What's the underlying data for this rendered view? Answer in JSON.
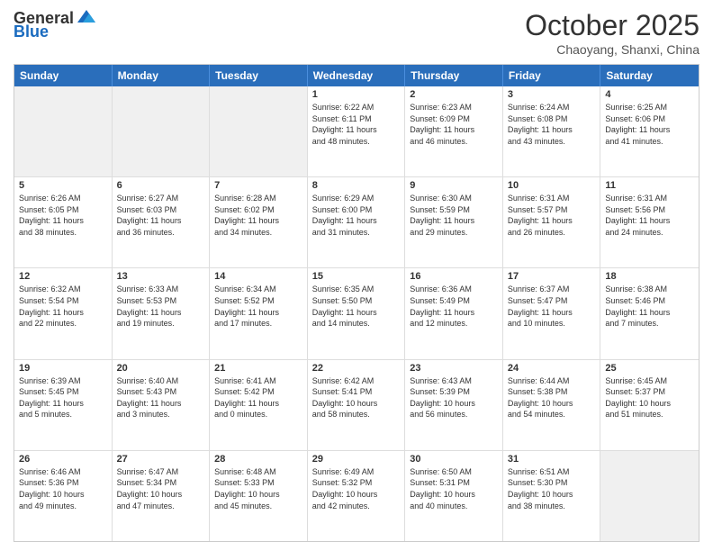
{
  "header": {
    "logo_general": "General",
    "logo_blue": "Blue",
    "title": "October 2025",
    "location": "Chaoyang, Shanxi, China"
  },
  "weekdays": [
    "Sunday",
    "Monday",
    "Tuesday",
    "Wednesday",
    "Thursday",
    "Friday",
    "Saturday"
  ],
  "rows": [
    [
      {
        "day": "",
        "info": "",
        "shaded": true
      },
      {
        "day": "",
        "info": "",
        "shaded": true
      },
      {
        "day": "",
        "info": "",
        "shaded": true
      },
      {
        "day": "1",
        "info": "Sunrise: 6:22 AM\nSunset: 6:11 PM\nDaylight: 11 hours\nand 48 minutes.",
        "shaded": false
      },
      {
        "day": "2",
        "info": "Sunrise: 6:23 AM\nSunset: 6:09 PM\nDaylight: 11 hours\nand 46 minutes.",
        "shaded": false
      },
      {
        "day": "3",
        "info": "Sunrise: 6:24 AM\nSunset: 6:08 PM\nDaylight: 11 hours\nand 43 minutes.",
        "shaded": false
      },
      {
        "day": "4",
        "info": "Sunrise: 6:25 AM\nSunset: 6:06 PM\nDaylight: 11 hours\nand 41 minutes.",
        "shaded": false
      }
    ],
    [
      {
        "day": "5",
        "info": "Sunrise: 6:26 AM\nSunset: 6:05 PM\nDaylight: 11 hours\nand 38 minutes.",
        "shaded": false
      },
      {
        "day": "6",
        "info": "Sunrise: 6:27 AM\nSunset: 6:03 PM\nDaylight: 11 hours\nand 36 minutes.",
        "shaded": false
      },
      {
        "day": "7",
        "info": "Sunrise: 6:28 AM\nSunset: 6:02 PM\nDaylight: 11 hours\nand 34 minutes.",
        "shaded": false
      },
      {
        "day": "8",
        "info": "Sunrise: 6:29 AM\nSunset: 6:00 PM\nDaylight: 11 hours\nand 31 minutes.",
        "shaded": false
      },
      {
        "day": "9",
        "info": "Sunrise: 6:30 AM\nSunset: 5:59 PM\nDaylight: 11 hours\nand 29 minutes.",
        "shaded": false
      },
      {
        "day": "10",
        "info": "Sunrise: 6:31 AM\nSunset: 5:57 PM\nDaylight: 11 hours\nand 26 minutes.",
        "shaded": false
      },
      {
        "day": "11",
        "info": "Sunrise: 6:31 AM\nSunset: 5:56 PM\nDaylight: 11 hours\nand 24 minutes.",
        "shaded": false
      }
    ],
    [
      {
        "day": "12",
        "info": "Sunrise: 6:32 AM\nSunset: 5:54 PM\nDaylight: 11 hours\nand 22 minutes.",
        "shaded": false
      },
      {
        "day": "13",
        "info": "Sunrise: 6:33 AM\nSunset: 5:53 PM\nDaylight: 11 hours\nand 19 minutes.",
        "shaded": false
      },
      {
        "day": "14",
        "info": "Sunrise: 6:34 AM\nSunset: 5:52 PM\nDaylight: 11 hours\nand 17 minutes.",
        "shaded": false
      },
      {
        "day": "15",
        "info": "Sunrise: 6:35 AM\nSunset: 5:50 PM\nDaylight: 11 hours\nand 14 minutes.",
        "shaded": false
      },
      {
        "day": "16",
        "info": "Sunrise: 6:36 AM\nSunset: 5:49 PM\nDaylight: 11 hours\nand 12 minutes.",
        "shaded": false
      },
      {
        "day": "17",
        "info": "Sunrise: 6:37 AM\nSunset: 5:47 PM\nDaylight: 11 hours\nand 10 minutes.",
        "shaded": false
      },
      {
        "day": "18",
        "info": "Sunrise: 6:38 AM\nSunset: 5:46 PM\nDaylight: 11 hours\nand 7 minutes.",
        "shaded": false
      }
    ],
    [
      {
        "day": "19",
        "info": "Sunrise: 6:39 AM\nSunset: 5:45 PM\nDaylight: 11 hours\nand 5 minutes.",
        "shaded": false
      },
      {
        "day": "20",
        "info": "Sunrise: 6:40 AM\nSunset: 5:43 PM\nDaylight: 11 hours\nand 3 minutes.",
        "shaded": false
      },
      {
        "day": "21",
        "info": "Sunrise: 6:41 AM\nSunset: 5:42 PM\nDaylight: 11 hours\nand 0 minutes.",
        "shaded": false
      },
      {
        "day": "22",
        "info": "Sunrise: 6:42 AM\nSunset: 5:41 PM\nDaylight: 10 hours\nand 58 minutes.",
        "shaded": false
      },
      {
        "day": "23",
        "info": "Sunrise: 6:43 AM\nSunset: 5:39 PM\nDaylight: 10 hours\nand 56 minutes.",
        "shaded": false
      },
      {
        "day": "24",
        "info": "Sunrise: 6:44 AM\nSunset: 5:38 PM\nDaylight: 10 hours\nand 54 minutes.",
        "shaded": false
      },
      {
        "day": "25",
        "info": "Sunrise: 6:45 AM\nSunset: 5:37 PM\nDaylight: 10 hours\nand 51 minutes.",
        "shaded": false
      }
    ],
    [
      {
        "day": "26",
        "info": "Sunrise: 6:46 AM\nSunset: 5:36 PM\nDaylight: 10 hours\nand 49 minutes.",
        "shaded": false
      },
      {
        "day": "27",
        "info": "Sunrise: 6:47 AM\nSunset: 5:34 PM\nDaylight: 10 hours\nand 47 minutes.",
        "shaded": false
      },
      {
        "day": "28",
        "info": "Sunrise: 6:48 AM\nSunset: 5:33 PM\nDaylight: 10 hours\nand 45 minutes.",
        "shaded": false
      },
      {
        "day": "29",
        "info": "Sunrise: 6:49 AM\nSunset: 5:32 PM\nDaylight: 10 hours\nand 42 minutes.",
        "shaded": false
      },
      {
        "day": "30",
        "info": "Sunrise: 6:50 AM\nSunset: 5:31 PM\nDaylight: 10 hours\nand 40 minutes.",
        "shaded": false
      },
      {
        "day": "31",
        "info": "Sunrise: 6:51 AM\nSunset: 5:30 PM\nDaylight: 10 hours\nand 38 minutes.",
        "shaded": false
      },
      {
        "day": "",
        "info": "",
        "shaded": true
      }
    ]
  ]
}
